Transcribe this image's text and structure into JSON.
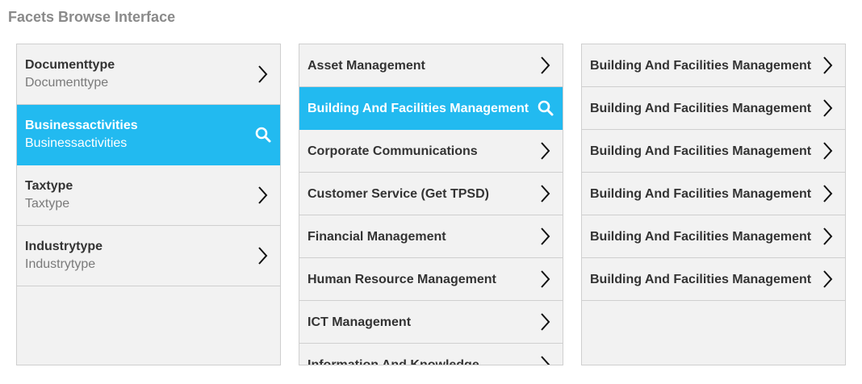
{
  "page": {
    "title": "Facets Browse Interface"
  },
  "columns": [
    {
      "items": [
        {
          "title": "Documenttype",
          "subtitle": "Documenttype",
          "icon": "chevron-right-icon"
        },
        {
          "title": "Businessactivities",
          "subtitle": "Businessactivities",
          "icon": "search-icon",
          "selected": true
        },
        {
          "title": "Taxtype",
          "subtitle": "Taxtype",
          "icon": "chevron-right-icon"
        },
        {
          "title": "Industrytype",
          "subtitle": "Industrytype",
          "icon": "chevron-right-icon"
        }
      ]
    },
    {
      "items": [
        {
          "title": "Asset Management",
          "icon": "chevron-right-icon"
        },
        {
          "title": "Building And Facilities Management",
          "icon": "search-icon",
          "selected": true
        },
        {
          "title": "Corporate Communications",
          "icon": "chevron-right-icon"
        },
        {
          "title": "Customer Service (Get TPSD)",
          "icon": "chevron-right-icon"
        },
        {
          "title": "Financial Management",
          "icon": "chevron-right-icon"
        },
        {
          "title": "Human Resource Management",
          "icon": "chevron-right-icon"
        },
        {
          "title": "ICT Management",
          "icon": "chevron-right-icon"
        },
        {
          "title": "Information And Knowledge",
          "icon": "chevron-right-icon"
        }
      ]
    },
    {
      "items": [
        {
          "title": "Building And Facilities Management",
          "icon": "chevron-right-icon"
        },
        {
          "title": "Building And Facilities Management",
          "icon": "chevron-right-icon"
        },
        {
          "title": "Building And Facilities Management",
          "icon": "chevron-right-icon"
        },
        {
          "title": "Building And Facilities Management",
          "icon": "chevron-right-icon"
        },
        {
          "title": "Building And Facilities Management",
          "icon": "chevron-right-icon"
        },
        {
          "title": "Building And Facilities Management",
          "icon": "chevron-right-icon"
        }
      ]
    }
  ],
  "colors": {
    "selected": "#22baf0",
    "panel": "#f2f2f2",
    "text": "#333333",
    "subtext": "#7a7a7a"
  }
}
